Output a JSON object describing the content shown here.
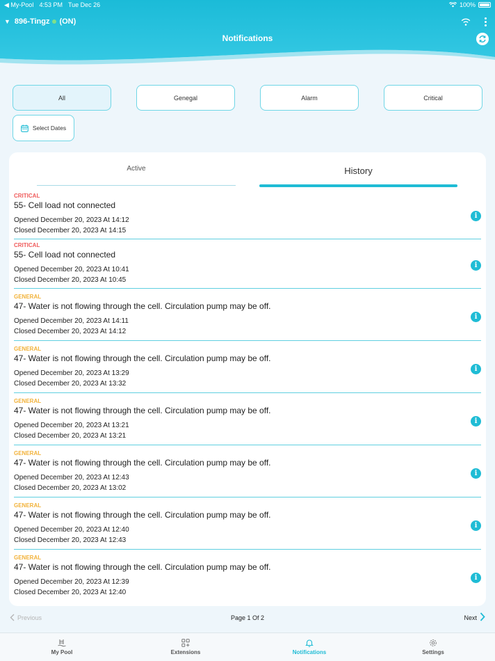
{
  "status_bar": {
    "back_app": "My-Pool",
    "time": "4:53 PM",
    "date": "Tue Dec 26",
    "battery": "100%"
  },
  "device": {
    "name": "896-Tingz",
    "state": "(ON)"
  },
  "header": {
    "title": "Notifications"
  },
  "filters": {
    "items": [
      {
        "label": "All"
      },
      {
        "label": "Genegal"
      },
      {
        "label": "Alarm"
      },
      {
        "label": "Critical"
      }
    ],
    "select_dates": "Select Dates"
  },
  "tabs": {
    "active": "Active",
    "history": "History"
  },
  "notifications": [
    {
      "severity": "CRITICAL",
      "title": "55- Cell load not connected",
      "opened": "Opened December 20, 2023 At 14:12",
      "closed": "Closed December 20, 2023 At 14:15"
    },
    {
      "severity": "CRITICAL",
      "title": "55- Cell load not connected",
      "opened": "Opened December 20, 2023 At 10:41",
      "closed": "Closed December 20, 2023 At 10:45"
    },
    {
      "severity": "GENERAL",
      "title": "47- Water is not flowing through the cell. Circulation pump may be off.",
      "opened": "Opened December 20, 2023 At 14:11",
      "closed": "Closed December 20, 2023 At 14:12"
    },
    {
      "severity": "GENERAL",
      "title": "47- Water is not flowing through the cell. Circulation pump may be off.",
      "opened": "Opened December 20, 2023 At 13:29",
      "closed": "Closed December 20, 2023 At 13:32"
    },
    {
      "severity": "GENERAL",
      "title": "47- Water is not flowing through the cell. Circulation pump may be off.",
      "opened": "Opened December 20, 2023 At 13:21",
      "closed": "Closed December 20, 2023 At 13:21"
    },
    {
      "severity": "GENERAL",
      "title": "47- Water is not flowing through the cell. Circulation pump may be off.",
      "opened": "Opened December 20, 2023 At 12:43",
      "closed": "Closed December 20, 2023 At 13:02"
    },
    {
      "severity": "GENERAL",
      "title": "47- Water is not flowing through the cell. Circulation pump may be off.",
      "opened": "Opened December 20, 2023 At 12:40",
      "closed": "Closed December 20, 2023 At 12:43"
    },
    {
      "severity": "GENERAL",
      "title": "47- Water is not flowing through the cell. Circulation pump may be off.",
      "opened": "Opened December 20, 2023 At 12:39",
      "closed": "Closed December 20, 2023 At 12:40"
    }
  ],
  "pagination": {
    "previous": "Previous",
    "page": "Page 1 Of 2",
    "next": "Next"
  },
  "tabbar": {
    "items": [
      {
        "label": "My Pool"
      },
      {
        "label": "Extensions"
      },
      {
        "label": "Notifications"
      },
      {
        "label": "Settings"
      }
    ]
  },
  "colors": {
    "accent": "#1fbcd5",
    "critical": "#ef5a5a",
    "general": "#f2b23a"
  }
}
